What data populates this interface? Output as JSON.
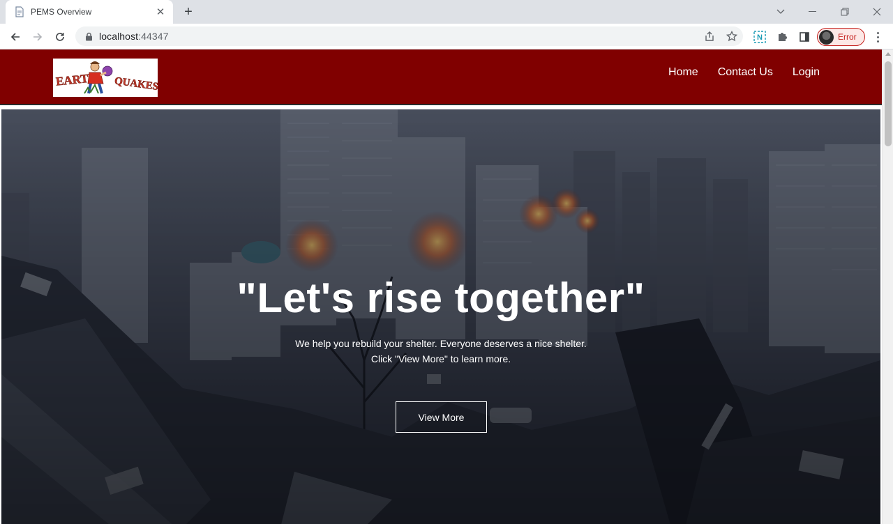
{
  "browser": {
    "tab_title": "PEMS Overview",
    "url_host": "localhost",
    "url_port": ":44347",
    "profile_label": "Error",
    "accent_error": "#c5221f"
  },
  "site": {
    "logo_text": "EARTHQUAKES",
    "header_color": "#800000",
    "nav": [
      {
        "label": "Home"
      },
      {
        "label": "Contact Us"
      },
      {
        "label": "Login"
      }
    ]
  },
  "hero": {
    "title": "\"Let's rise together\"",
    "subtitle_line1": "We help you rebuild your shelter. Everyone deserves a nice shelter.",
    "subtitle_line2": "Click \"View More\" to learn more.",
    "button_label": "View More",
    "background_description_icon": "destroyed-city-image"
  }
}
